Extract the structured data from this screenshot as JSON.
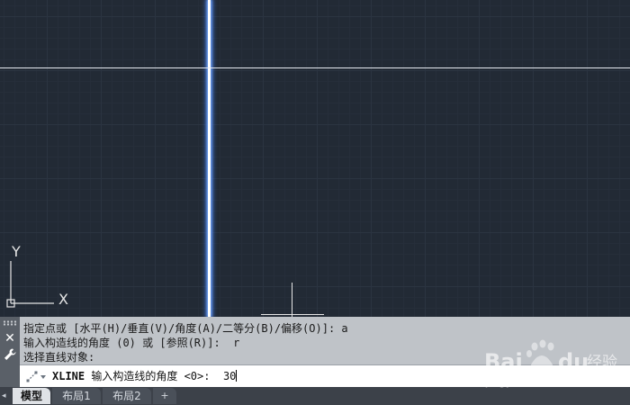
{
  "viewport": {
    "ucs": {
      "y_label": "Y",
      "x_label": "X"
    }
  },
  "command_history": [
    "指定点或 [水平(H)/垂直(V)/角度(A)/二等分(B)/偏移(O)]: a",
    "输入构造线的角度 (0) 或 [参照(R)]:  r",
    "选择直线对象:"
  ],
  "command_line": {
    "command": "XLINE",
    "prompt": " 输入构造线的角度 <0>:  ",
    "value": "30",
    "icon": "command-prompt-icon"
  },
  "panel_icons": [
    "close-icon",
    "wrench-icon"
  ],
  "tabs": [
    {
      "label": "模型",
      "active": true
    },
    {
      "label": "布局1",
      "active": false
    },
    {
      "label": "布局2",
      "active": false
    },
    {
      "label": "+",
      "active": false
    }
  ],
  "watermark": {
    "text": "Bai du 经验",
    "url": "jingyan.baidu.com"
  },
  "colors": {
    "canvas": "#222a35",
    "grid": "#2b3441",
    "crosshair": "#e6e6e6",
    "command_panel": "#bfc3c8"
  }
}
